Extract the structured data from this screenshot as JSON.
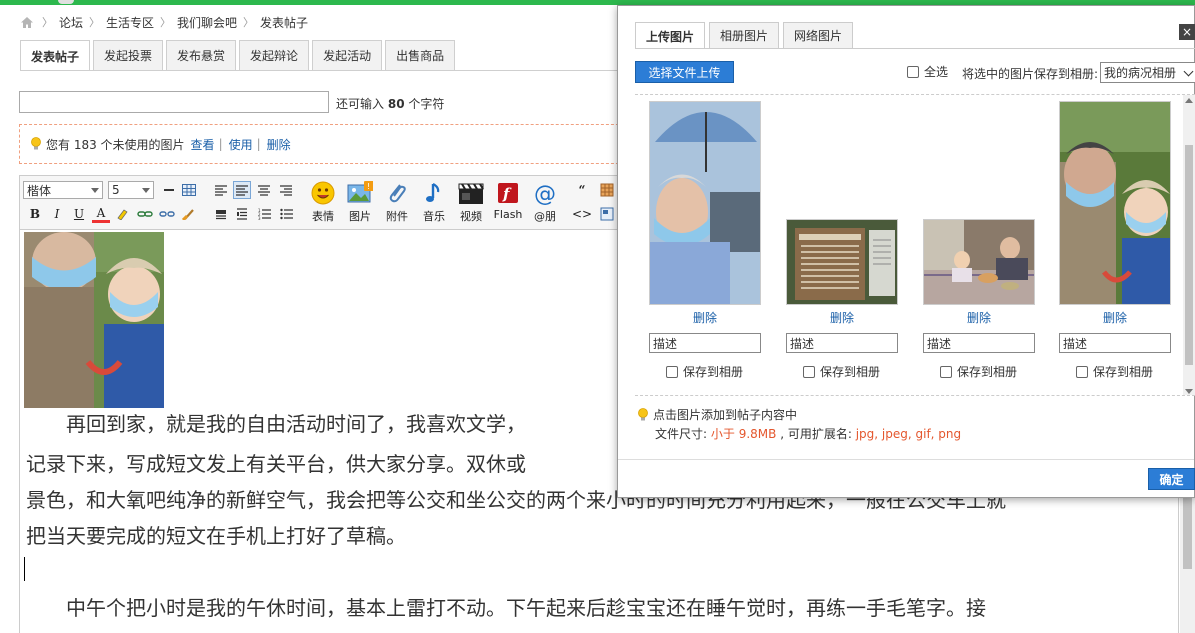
{
  "breadcrumb": {
    "home_icon": "home-icon",
    "items": [
      "论坛",
      "生活专区",
      "我们聊会吧",
      "发表帖子"
    ]
  },
  "tabs": [
    "发表帖子",
    "发起投票",
    "发布悬赏",
    "发起辩论",
    "发起活动",
    "出售商品"
  ],
  "title_field": {
    "value": "",
    "hint_prefix": "还可输入",
    "hint_count": "80",
    "hint_suffix": "个字符"
  },
  "notice": {
    "text": "您有 183 个未使用的图片",
    "view": "查看",
    "use": "使用",
    "delete": "删除"
  },
  "toolbar": {
    "font": "楷体",
    "size": "5",
    "bold": "B",
    "italic": "I",
    "underline": "U",
    "font_color": "A",
    "quote": "“",
    "code": "<>",
    "big_buttons": {
      "emoji": "表情",
      "image": "图片",
      "attachment": "附件",
      "music": "音乐",
      "video": "视频",
      "flash": "Flash",
      "mention": "@朋"
    }
  },
  "editor": {
    "paragraphs": [
      "　　再回到家，就是我的自由活动时间了，我喜欢文学，",
      "记录下来，写成短文发上有关平台，供大家分享。双休或",
      "景色，和大氧吧纯净的新鲜空气，我会把等公交和坐公交的两个来小时的时间充分利用起来，一般在公交车上就",
      "把当天要完成的短文在手机上打好了草稿。",
      "　　中午个把小时是我的午休时间，基本上雷打不动。下午起来后趁宝宝还在睡午觉时，再练一手毛笔字。接"
    ]
  },
  "dialog": {
    "tabs": [
      "上传图片",
      "相册图片",
      "网络图片"
    ],
    "close": "×",
    "upload_button": "选择文件上传",
    "select_all": "全选",
    "save_hint": "将选中的图片保存到相册:",
    "album": "我的病况相册",
    "items": [
      {
        "delete": "删除",
        "desc_placeholder": "描述",
        "save": "保存到相册"
      },
      {
        "delete": "删除",
        "desc_placeholder": "描述",
        "save": "保存到相册"
      },
      {
        "delete": "删除",
        "desc_placeholder": "描述",
        "save": "保存到相册"
      },
      {
        "delete": "删除",
        "desc_placeholder": "描述",
        "save": "保存到相册"
      }
    ],
    "tip": "点击图片添加到帖子内容中",
    "size_label": "文件尺寸:",
    "size_value": "小于 9.8MB",
    "ext_label": ", 可用扩展名:",
    "ext_value": "jpg, jpeg, gif, png",
    "ok": "确定"
  },
  "colors": {
    "accent": "#2c7dd6",
    "link": "#1a5fa8",
    "warning": "#e4572e",
    "topbar": "#2db84d"
  }
}
